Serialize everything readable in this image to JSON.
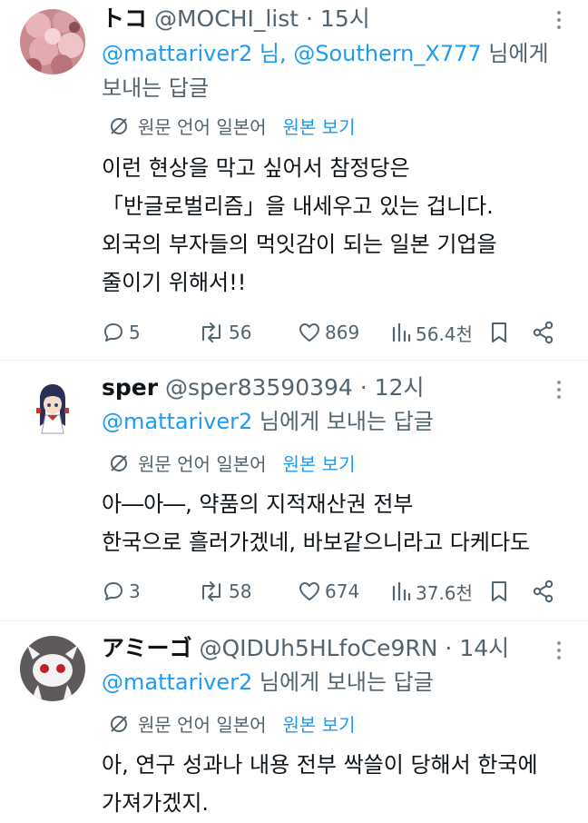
{
  "tweets": [
    {
      "name": "トコ",
      "handle": "@MOCHI_list",
      "time": "15시",
      "reply_mentions": "@mattariver2 님, @Southern_X777",
      "reply_suffix_1": "님에게",
      "reply_line2": "보내는 답글",
      "translate_label": "원문 언어 일본어",
      "show_original": "원본 보기",
      "body": [
        "이런 현상을 막고 싶어서 참정당은",
        "「반글로벌리즘」을 내세우고 있는 겁니다.",
        "외국의 부자들의 먹잇감이 되는 일본 기업을",
        "줄이기 위해서!!"
      ],
      "replies": "5",
      "retweets": "56",
      "likes": "869",
      "views": "56.4천",
      "avatar_icon": "cherry-blossom-avatar"
    },
    {
      "name": "sper",
      "handle": "@sper83590394",
      "time": "12시",
      "reply_mentions": "@mattariver2",
      "reply_suffix_1": "님에게 보내는 답글",
      "translate_label": "원문 언어 일본어",
      "show_original": "원본 보기",
      "body": [
        "아―아―, 약품의 지적재산권 전부",
        "한국으로 흘러가겠네, 바보같으니라고 다케다도"
      ],
      "replies": "3",
      "retweets": "58",
      "likes": "674",
      "views": "37.6천",
      "avatar_icon": "anime-girl-avatar"
    },
    {
      "name": "アミーゴ",
      "handle": "@QIDUh5HLfoCe9RN",
      "time": "14시",
      "reply_mentions": "@mattariver2",
      "reply_suffix_1": "님에게 보내는 답글",
      "translate_label": "원문 언어 일본어",
      "show_original": "원본 보기",
      "body": [
        "아, 연구 성과나 내용 전부 싹쓸이 당해서 한국에",
        "가져가겠지."
      ],
      "avatar_icon": "white-creature-avatar"
    }
  ],
  "separator": " · ",
  "colors": {
    "accent": "#1d9bf0",
    "muted": "#536471",
    "text": "#0f1419",
    "divider": "#eff3f4"
  }
}
